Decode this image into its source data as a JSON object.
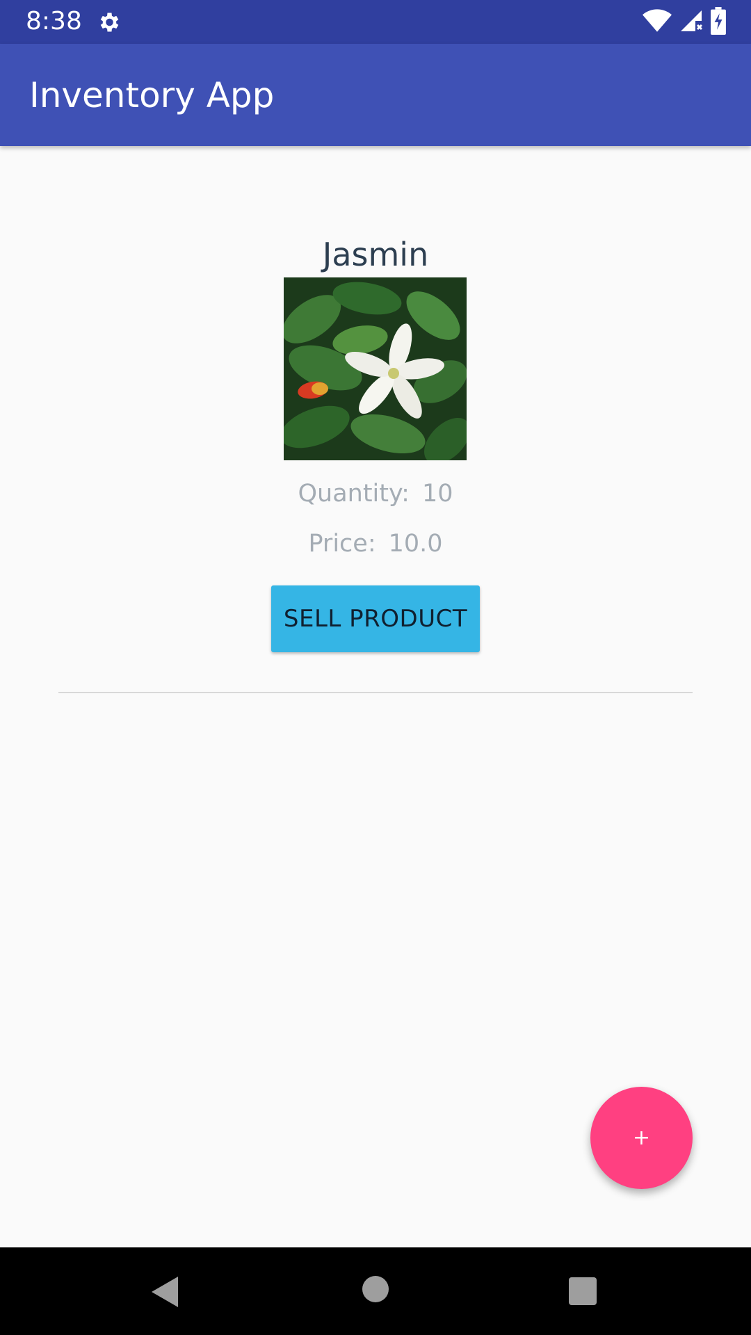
{
  "status_bar": {
    "time": "8:38",
    "icons": [
      "gear-icon",
      "wifi-icon",
      "cell-signal-icon",
      "battery-charging-icon"
    ]
  },
  "app_bar": {
    "title": "Inventory App"
  },
  "product": {
    "name": "Jasmin",
    "image_icon": "jasmine-flower-photo",
    "quantity_label": "Quantity:",
    "quantity_value": "10",
    "price_label": "Price:",
    "price_value": "10.0",
    "sell_button_label": "SELL PRODUCT"
  },
  "fab": {
    "icon": "+"
  },
  "nav_bar": {
    "icons": [
      "back-icon",
      "home-icon",
      "recents-icon"
    ]
  },
  "colors": {
    "status_bar": "#303f9f",
    "app_bar": "#3f51b5",
    "sell_button": "#35b5e5",
    "fab": "#ff4081",
    "background": "#fafafa"
  }
}
